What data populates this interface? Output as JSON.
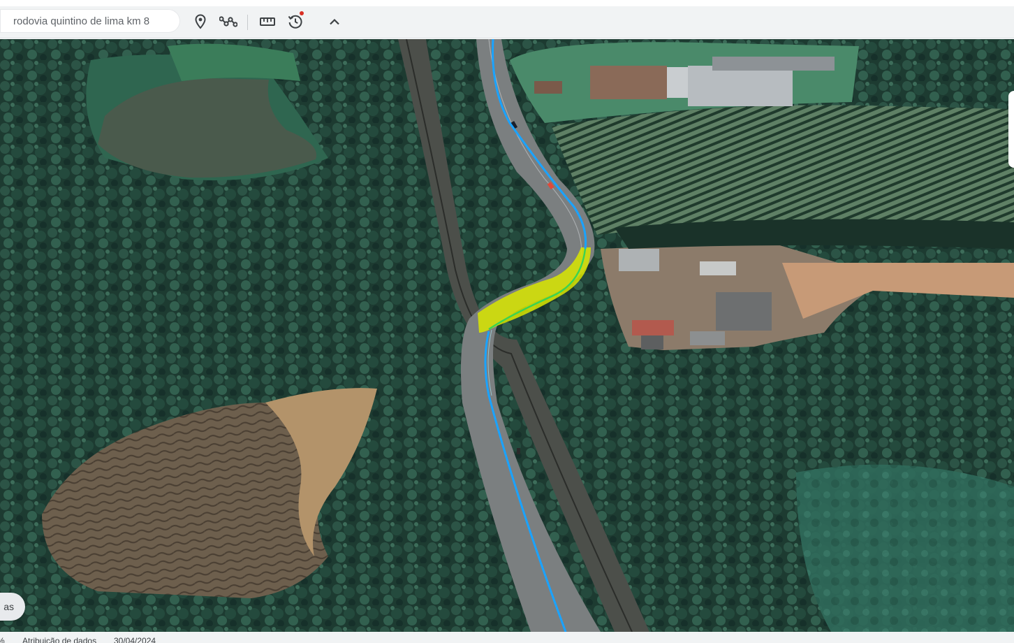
{
  "search": {
    "value": "rodovia quintino de lima km 8"
  },
  "toolbar": {
    "icons": [
      "placemark-icon",
      "path-icon",
      "ruler-icon",
      "historical-imagery-icon",
      "chevron-up-icon"
    ],
    "notification_dot_color": "#d93025"
  },
  "map": {
    "route_color": "#1aa3ff",
    "highlight_color": "#d9e600",
    "highlight_edge_color": "#39d353"
  },
  "layers_pill": {
    "label": "as"
  },
  "status_bar": {
    "zoom": "%",
    "attribution": "Atribuição de dados",
    "date": "30/04/2024"
  }
}
